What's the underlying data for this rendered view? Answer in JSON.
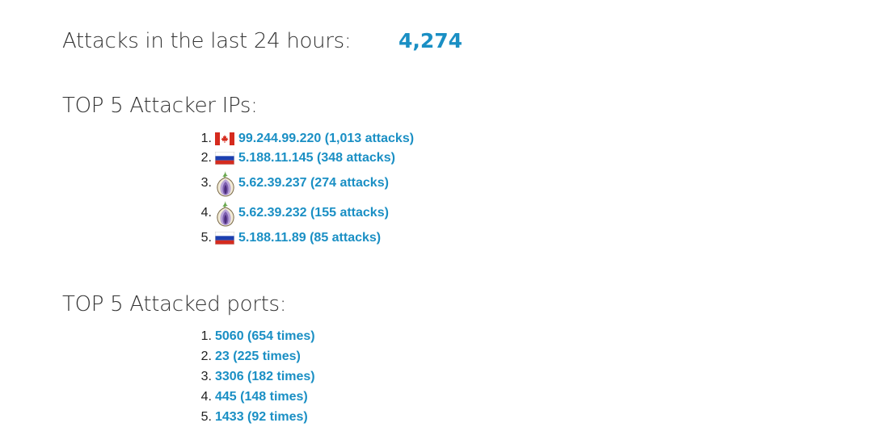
{
  "stats": {
    "label": "Attacks in the last 24 hours:",
    "count": "4,274"
  },
  "attacker_ips": {
    "title": "TOP 5 Attacker IPs:",
    "items": [
      {
        "number": "1.",
        "icon": "canada-flag-icon",
        "text": "99.244.99.220 (1,013 attacks)"
      },
      {
        "number": "2.",
        "icon": "russia-flag-icon",
        "text": "5.188.11.145 (348 attacks)"
      },
      {
        "number": "3.",
        "icon": "tor-onion-icon",
        "text": "5.62.39.237 (274 attacks)"
      },
      {
        "number": "4.",
        "icon": "tor-onion-icon",
        "text": "5.62.39.232 (155 attacks)"
      },
      {
        "number": "5.",
        "icon": "russia-flag-icon",
        "text": "5.188.11.89 (85 attacks)"
      }
    ]
  },
  "attacked_ports": {
    "title": "TOP 5 Attacked ports:",
    "items": [
      {
        "number": "1.",
        "text": "5060 (654 times)"
      },
      {
        "number": "2.",
        "text": "23 (225 times)"
      },
      {
        "number": "3.",
        "text": "3306 (182 times)"
      },
      {
        "number": "4.",
        "text": "445 (148 times)"
      },
      {
        "number": "5.",
        "text": "1433 (92 times)"
      }
    ]
  },
  "colors": {
    "accent": "#1a8fc4",
    "heading": "#333333"
  }
}
